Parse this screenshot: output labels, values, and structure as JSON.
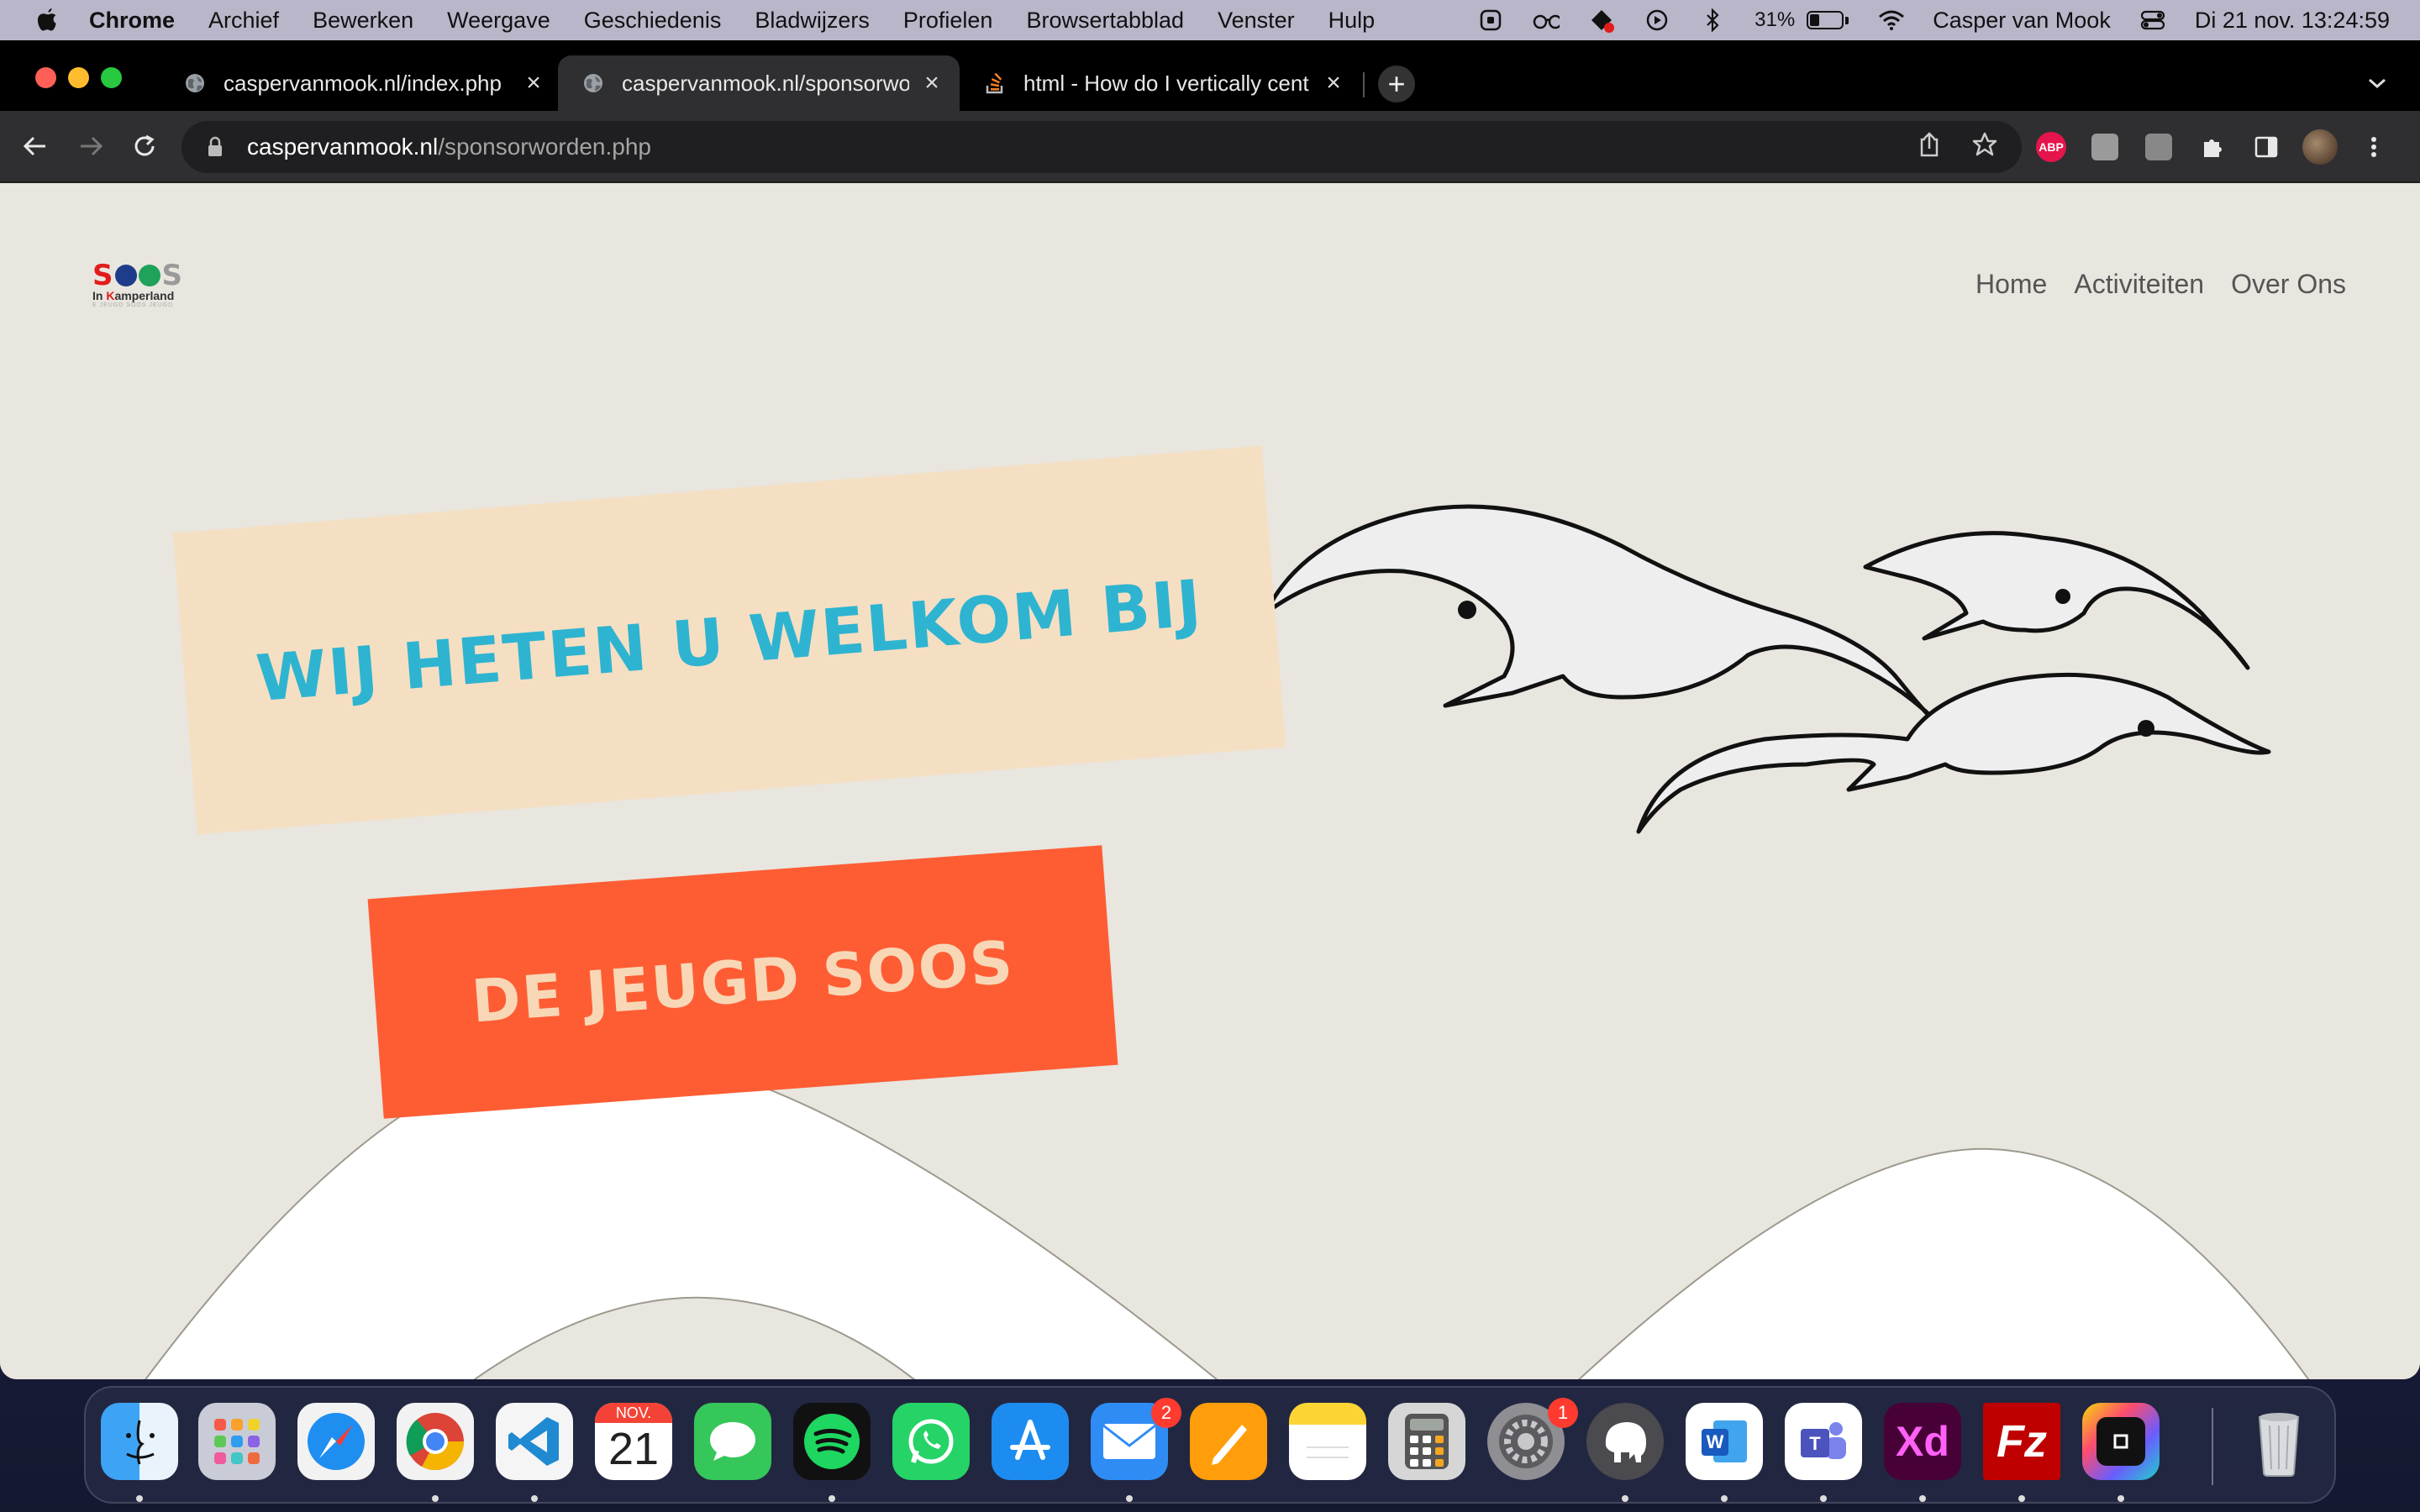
{
  "menubar": {
    "app_name": "Chrome",
    "menus": [
      "Archief",
      "Bewerken",
      "Weergave",
      "Geschiedenis",
      "Bladwijzers",
      "Profielen",
      "Browsertabblad",
      "Venster",
      "Hulp"
    ],
    "battery_pct": "31%",
    "battery_level": 0.31,
    "user_name": "Casper van Mook",
    "datetime": "Di 21 nov.  13:24:59",
    "status_icons": [
      "screen-record-icon",
      "reading-glasses-icon",
      "creative-cloud-icon",
      "media-play-icon",
      "bluetooth-icon",
      "battery-icon",
      "wifi-icon",
      "control-center-icon"
    ]
  },
  "browser": {
    "tabs": [
      {
        "title": "caspervanmook.nl/index.php",
        "favicon": "globe-icon",
        "active": false
      },
      {
        "title": "caspervanmook.nl/sponsorwo",
        "favicon": "globe-icon",
        "active": true
      },
      {
        "title": "html - How do I vertically cent",
        "favicon": "stackoverflow-icon",
        "active": false
      }
    ],
    "url_host": "caspervanmook.nl",
    "url_path": "/sponsorworden.php",
    "extensions": [
      "adblock-plus-icon",
      "extension-icon",
      "extension-icon",
      "puzzle-icon",
      "side-panel-icon"
    ]
  },
  "site": {
    "logo": {
      "letters": [
        "S",
        "O",
        "O",
        "S"
      ],
      "subtitle_k": "K",
      "subtitle_start": "In ",
      "subtitle_end": "amperland",
      "tagline": "E JEUGD SOOS JEUGD"
    },
    "nav": [
      "Home",
      "Activiteiten",
      "Over Ons"
    ],
    "hero_line1": "WIJ HETEN U WELKOM BIJ",
    "hero_line2": "DE JEUGD SOOS"
  },
  "colors": {
    "page_bg": "#e8e6df",
    "welcome_box": "#f5dfc3",
    "welcome_text": "#2eb4d1",
    "soos_box": "#fe5d34",
    "soos_text": "#f8d7b6"
  },
  "dock": {
    "apps": [
      {
        "name": "Finder",
        "icon": "finder-icon",
        "running": true
      },
      {
        "name": "Launchpad",
        "icon": "launchpad-icon",
        "running": false
      },
      {
        "name": "Safari",
        "icon": "safari-icon",
        "running": false
      },
      {
        "name": "Google Chrome",
        "icon": "chrome-icon",
        "running": true
      },
      {
        "name": "Visual Studio Code",
        "icon": "vscode-icon",
        "running": true
      },
      {
        "name": "Calendar",
        "icon": "calendar-icon",
        "running": false,
        "month": "NOV.",
        "day": "21"
      },
      {
        "name": "Messages",
        "icon": "messages-icon",
        "running": false
      },
      {
        "name": "Spotify",
        "icon": "spotify-icon",
        "running": true
      },
      {
        "name": "WhatsApp",
        "icon": "whatsapp-icon",
        "running": false
      },
      {
        "name": "App Store",
        "icon": "app-store-icon",
        "running": false
      },
      {
        "name": "Mail",
        "icon": "mail-icon",
        "running": true,
        "badge": "2"
      },
      {
        "name": "Pages",
        "icon": "pages-icon",
        "running": false
      },
      {
        "name": "Notes",
        "icon": "notes-icon",
        "running": false
      },
      {
        "name": "Calculator",
        "icon": "calculator-icon",
        "running": false
      },
      {
        "name": "System Settings",
        "icon": "settings-icon",
        "running": false,
        "badge": "1"
      },
      {
        "name": "Sequel Pro",
        "icon": "sequel-pro-icon",
        "running": true
      },
      {
        "name": "Microsoft Word",
        "icon": "word-icon",
        "running": true
      },
      {
        "name": "Microsoft Teams",
        "icon": "teams-icon",
        "running": true
      },
      {
        "name": "Adobe XD",
        "icon": "xd-icon",
        "running": true,
        "label": "Xd"
      },
      {
        "name": "FileZilla",
        "icon": "filezilla-icon",
        "running": true
      },
      {
        "name": "Screen tool",
        "icon": "screen-tool-icon",
        "running": true
      },
      {
        "name": "Trash",
        "icon": "trash-icon",
        "running": false
      }
    ]
  }
}
